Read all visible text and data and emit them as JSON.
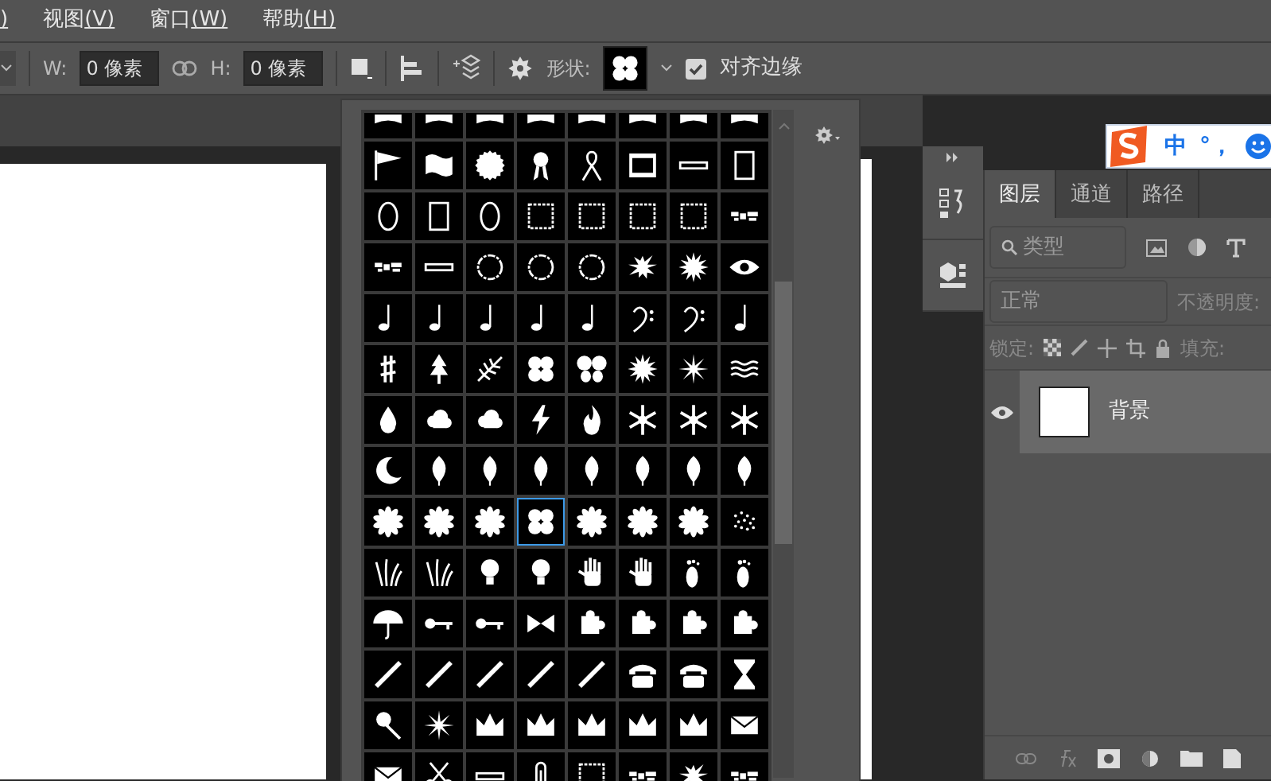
{
  "menu": [
    {
      "key": ")"
    },
    {
      "label": "视图",
      "key": "(V)"
    },
    {
      "label": "窗口",
      "key": "(W)"
    },
    {
      "label": "帮助",
      "key": "(H)"
    }
  ],
  "options_bar": {
    "w_label": "W:",
    "w_value": "0 像素",
    "h_label": "H:",
    "h_value": "0 像素",
    "shape_label": "形状:",
    "shape_preview": {
      "kind": "clover"
    },
    "align_edges": {
      "label": "对齐边缘",
      "checked": true
    }
  },
  "shape_picker": {
    "rows": [
      {
        "clipped_top": true,
        "clipped_bottom": false,
        "shapes": [
          {
            "kind": "banner",
            "selected": false
          },
          {
            "kind": "banner",
            "selected": false
          },
          {
            "kind": "banner",
            "selected": false
          },
          {
            "kind": "banner",
            "selected": false
          },
          {
            "kind": "banner",
            "selected": false
          },
          {
            "kind": "banner",
            "selected": false
          },
          {
            "kind": "banner",
            "selected": false
          },
          {
            "kind": "banner",
            "selected": false
          }
        ]
      },
      {
        "clipped_top": false,
        "clipped_bottom": false,
        "shapes": [
          {
            "kind": "flag",
            "selected": false
          },
          {
            "kind": "wave",
            "selected": false
          },
          {
            "kind": "seal",
            "selected": false
          },
          {
            "kind": "award",
            "selected": false
          },
          {
            "kind": "ribbon",
            "selected": false
          },
          {
            "kind": "film",
            "selected": false
          },
          {
            "kind": "ruler",
            "selected": false
          },
          {
            "kind": "frame",
            "selected": false
          }
        ]
      },
      {
        "clipped_top": false,
        "clipped_bottom": false,
        "shapes": [
          {
            "kind": "oval",
            "selected": false
          },
          {
            "kind": "frame",
            "selected": false
          },
          {
            "kind": "oval",
            "selected": false
          },
          {
            "kind": "square",
            "selected": false
          },
          {
            "kind": "square",
            "selected": false
          },
          {
            "kind": "square",
            "selected": false
          },
          {
            "kind": "square",
            "selected": false
          },
          {
            "kind": "grunge",
            "selected": false
          }
        ]
      },
      {
        "clipped_top": false,
        "clipped_bottom": false,
        "shapes": [
          {
            "kind": "grunge",
            "selected": false
          },
          {
            "kind": "ruler",
            "selected": false
          },
          {
            "kind": "ring",
            "selected": false
          },
          {
            "kind": "ring",
            "selected": false
          },
          {
            "kind": "ring",
            "selected": false
          },
          {
            "kind": "splat",
            "selected": false
          },
          {
            "kind": "sun",
            "selected": false
          },
          {
            "kind": "eye",
            "selected": false
          }
        ]
      },
      {
        "clipped_top": false,
        "clipped_bottom": false,
        "shapes": [
          {
            "kind": "note",
            "selected": false
          },
          {
            "kind": "note",
            "selected": false
          },
          {
            "kind": "note",
            "selected": false
          },
          {
            "kind": "note",
            "selected": false
          },
          {
            "kind": "note",
            "selected": false
          },
          {
            "kind": "clef",
            "selected": false
          },
          {
            "kind": "clef",
            "selected": false
          },
          {
            "kind": "note",
            "selected": false
          }
        ]
      },
      {
        "clipped_top": false,
        "clipped_bottom": false,
        "shapes": [
          {
            "kind": "sharp",
            "selected": false
          },
          {
            "kind": "tree",
            "selected": false
          },
          {
            "kind": "fern",
            "selected": false
          },
          {
            "kind": "clover",
            "selected": false
          },
          {
            "kind": "butterfly",
            "selected": false
          },
          {
            "kind": "sun",
            "selected": false
          },
          {
            "kind": "star",
            "selected": false
          },
          {
            "kind": "waves",
            "selected": false
          }
        ]
      },
      {
        "clipped_top": false,
        "clipped_bottom": false,
        "shapes": [
          {
            "kind": "drop",
            "selected": false
          },
          {
            "kind": "cloud",
            "selected": false
          },
          {
            "kind": "cloud",
            "selected": false
          },
          {
            "kind": "bolt",
            "selected": false
          },
          {
            "kind": "flame",
            "selected": false
          },
          {
            "kind": "snowflake",
            "selected": false
          },
          {
            "kind": "snowflake",
            "selected": false
          },
          {
            "kind": "snowflake",
            "selected": false
          }
        ]
      },
      {
        "clipped_top": false,
        "clipped_bottom": false,
        "shapes": [
          {
            "kind": "moon",
            "selected": false
          },
          {
            "kind": "leaf",
            "selected": false
          },
          {
            "kind": "leaf",
            "selected": false
          },
          {
            "kind": "leaf",
            "selected": false
          },
          {
            "kind": "leaf",
            "selected": false
          },
          {
            "kind": "leaf",
            "selected": false
          },
          {
            "kind": "leaf",
            "selected": false
          },
          {
            "kind": "leaf",
            "selected": false
          }
        ]
      },
      {
        "clipped_top": false,
        "clipped_bottom": false,
        "shapes": [
          {
            "kind": "flower",
            "selected": false
          },
          {
            "kind": "flower",
            "selected": false
          },
          {
            "kind": "flower",
            "selected": false
          },
          {
            "kind": "clover",
            "selected": true
          },
          {
            "kind": "flower",
            "selected": false
          },
          {
            "kind": "flower",
            "selected": false
          },
          {
            "kind": "flower",
            "selected": false
          },
          {
            "kind": "dots",
            "selected": false
          }
        ]
      },
      {
        "clipped_top": false,
        "clipped_bottom": false,
        "shapes": [
          {
            "kind": "grass",
            "selected": false
          },
          {
            "kind": "grass",
            "selected": false
          },
          {
            "kind": "bulb",
            "selected": false
          },
          {
            "kind": "bulb",
            "selected": false
          },
          {
            "kind": "hand",
            "selected": false
          },
          {
            "kind": "hand",
            "selected": false
          },
          {
            "kind": "foot",
            "selected": false
          },
          {
            "kind": "foot",
            "selected": false
          }
        ]
      },
      {
        "clipped_top": false,
        "clipped_bottom": false,
        "shapes": [
          {
            "kind": "umbrella",
            "selected": false
          },
          {
            "kind": "key",
            "selected": false
          },
          {
            "kind": "key",
            "selected": false
          },
          {
            "kind": "bow",
            "selected": false
          },
          {
            "kind": "puzzle",
            "selected": false
          },
          {
            "kind": "puzzle",
            "selected": false
          },
          {
            "kind": "puzzle",
            "selected": false
          },
          {
            "kind": "puzzle",
            "selected": false
          }
        ]
      },
      {
        "clipped_top": false,
        "clipped_bottom": false,
        "shapes": [
          {
            "kind": "pencil",
            "selected": false
          },
          {
            "kind": "pencil",
            "selected": false
          },
          {
            "kind": "pencil",
            "selected": false
          },
          {
            "kind": "pencil",
            "selected": false
          },
          {
            "kind": "pencil",
            "selected": false
          },
          {
            "kind": "phone",
            "selected": false
          },
          {
            "kind": "phone",
            "selected": false
          },
          {
            "kind": "hourglass",
            "selected": false
          }
        ]
      },
      {
        "clipped_top": false,
        "clipped_bottom": false,
        "shapes": [
          {
            "kind": "pin",
            "selected": false
          },
          {
            "kind": "star",
            "selected": false
          },
          {
            "kind": "crown",
            "selected": false
          },
          {
            "kind": "crown",
            "selected": false
          },
          {
            "kind": "crown",
            "selected": false
          },
          {
            "kind": "crown",
            "selected": false
          },
          {
            "kind": "crown",
            "selected": false
          },
          {
            "kind": "envelope",
            "selected": false
          }
        ]
      },
      {
        "clipped_top": false,
        "clipped_bottom": true,
        "shapes": [
          {
            "kind": "envelope",
            "selected": false
          },
          {
            "kind": "scissors",
            "selected": false
          },
          {
            "kind": "ruler",
            "selected": false
          },
          {
            "kind": "clip",
            "selected": false
          },
          {
            "kind": "square",
            "selected": false
          },
          {
            "kind": "grunge",
            "selected": false
          },
          {
            "kind": "splat",
            "selected": false
          },
          {
            "kind": "grunge",
            "selected": false
          }
        ]
      }
    ]
  },
  "ime_bar": {
    "mode": "中",
    "punctuation": "°，"
  },
  "layers_panel": {
    "tabs": [
      {
        "label": "图层",
        "selected": true
      },
      {
        "label": "通道",
        "selected": false
      },
      {
        "label": "路径",
        "selected": false
      }
    ],
    "filter": {
      "value": "类型"
    },
    "blend_mode": {
      "value": "正常"
    },
    "opacity_label": "不透明度:",
    "lock_label": "锁定:",
    "fill_label": "填充:",
    "layers": [
      {
        "name": "背景",
        "visible": true,
        "selected": true
      }
    ]
  }
}
